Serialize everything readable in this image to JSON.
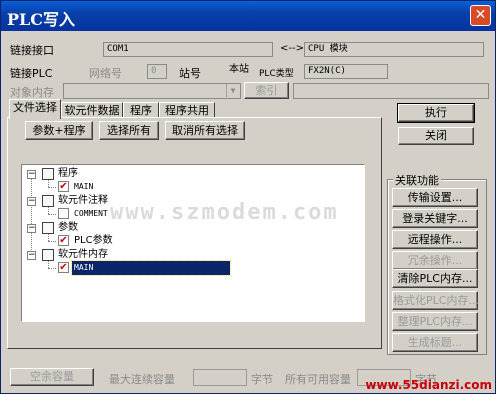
{
  "window": {
    "title": "PLC写入",
    "close_symbol": "✕"
  },
  "connection": {
    "link_label": "链接接口",
    "link_value": "COM1",
    "arrow": "<-->",
    "link_target_value": "CPU 模块",
    "link_plc_label": "链接PLC",
    "network_label": "网络号",
    "network_value": "0",
    "station_label": "站号",
    "station_value": "本站",
    "plc_type_label": "PLC类型",
    "plc_type_value": "FX2N(C)",
    "target_memory_label": "对象内存",
    "index_button": "索引"
  },
  "tabs": [
    {
      "label": "文件选择"
    },
    {
      "label": "软元件数据"
    },
    {
      "label": "程序"
    },
    {
      "label": "程序共用"
    }
  ],
  "file_buttons": {
    "params_program": "参数+程序",
    "select_all": "选择所有",
    "deselect_all": "取消所有选择"
  },
  "tree": {
    "program": "程序",
    "program_main": "MAIN",
    "comment": "软元件注释",
    "comment_item": "COMMENT",
    "params": "参数",
    "params_item": "PLC参数",
    "memory": "软元件内存",
    "memory_main": "MAIN"
  },
  "actions": {
    "execute": "执行",
    "close": "关闭"
  },
  "related": {
    "title": "关联功能",
    "buttons": [
      {
        "label": "传输设置...",
        "enabled": true
      },
      {
        "label": "登录关键字...",
        "enabled": true
      },
      {
        "label": "远程操作...",
        "enabled": true
      },
      {
        "label": "冗余操作...",
        "enabled": false
      },
      {
        "label": "清除PLC内存...",
        "enabled": true
      },
      {
        "label": "格式化PLC内存...",
        "enabled": false
      },
      {
        "label": "整理PLC内存...",
        "enabled": false
      },
      {
        "label": "生成标题...",
        "enabled": false
      }
    ]
  },
  "status": {
    "free_capacity": "空余容量",
    "max_continuous": "最大连续容量",
    "bytes_unit": "字节",
    "total_free": "所有可用容量",
    "bytes_unit2": "字节"
  },
  "overlay": {
    "watermark": "www.szmodem.com",
    "site": "www.55dianzi.com"
  },
  "colors": {
    "titlebar": "#0840a8",
    "face": "#d4d0c8",
    "selection": "#0a246a",
    "check_red": "#d40000"
  }
}
